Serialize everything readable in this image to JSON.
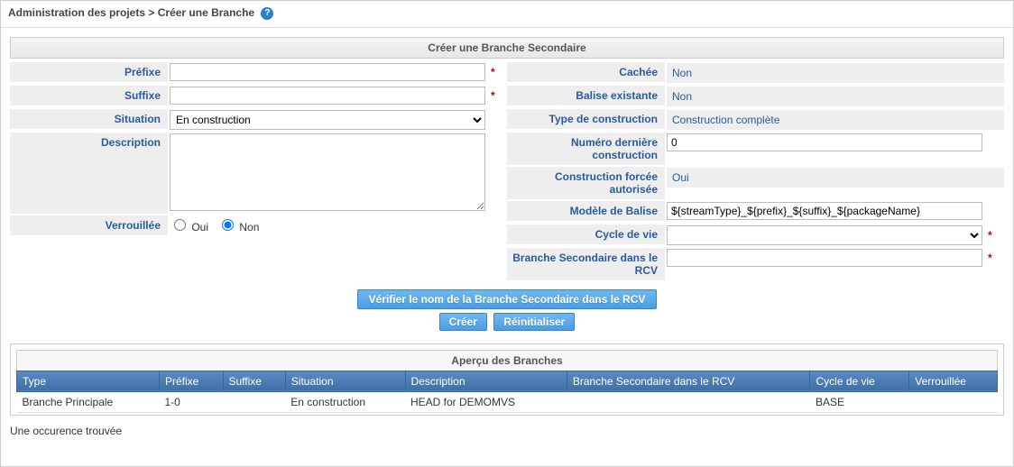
{
  "breadcrumb": {
    "parent": "Administration des projets",
    "sep": ">",
    "current": "Créer une Branche"
  },
  "panel_title": "Créer une Branche Secondaire",
  "left": {
    "prefix_label": "Préfixe",
    "prefix_value": "",
    "suffix_label": "Suffixe",
    "suffix_value": "",
    "situation_label": "Situation",
    "situation_value": "En construction",
    "description_label": "Description",
    "description_value": "",
    "locked_label": "Verrouillée",
    "locked_yes": "Oui",
    "locked_no": "Non",
    "locked_value": "Non"
  },
  "right": {
    "hidden_label": "Cachée",
    "hidden_value": "Non",
    "existing_tag_label": "Balise existante",
    "existing_tag_value": "Non",
    "build_type_label": "Type de construction",
    "build_type_value": "Construction complète",
    "last_build_label": "Numéro dernière construction",
    "last_build_value": "0",
    "forced_build_label": "Construction forcée autorisée",
    "forced_build_value": "Oui",
    "tag_model_label": "Modèle de Balise",
    "tag_model_value": "${streamType}_${prefix}_${suffix}_${packageName}",
    "lifecycle_label": "Cycle de vie",
    "lifecycle_value": "",
    "secondary_branch_label": "Branche Secondaire dans le RCV",
    "secondary_branch_value": ""
  },
  "buttons": {
    "verify": "Vérifier le nom de la Branche Secondaire dans le RCV",
    "create": "Créer",
    "reset": "Réinitialiser"
  },
  "table": {
    "title": "Aperçu des Branches",
    "columns": [
      "Type",
      "Préfixe",
      "Suffixe",
      "Situation",
      "Description",
      "Branche Secondaire dans le RCV",
      "Cycle de vie",
      "Verrouillée"
    ],
    "rows": [
      {
        "type": "Branche Principale",
        "prefix": "1-0",
        "suffix": "",
        "situation": "En construction",
        "description": "HEAD for DEMOMVS",
        "secondary": "",
        "lifecycle": "BASE",
        "locked": ""
      }
    ]
  },
  "footer": "Une occurence trouvée",
  "required_mark": "*"
}
